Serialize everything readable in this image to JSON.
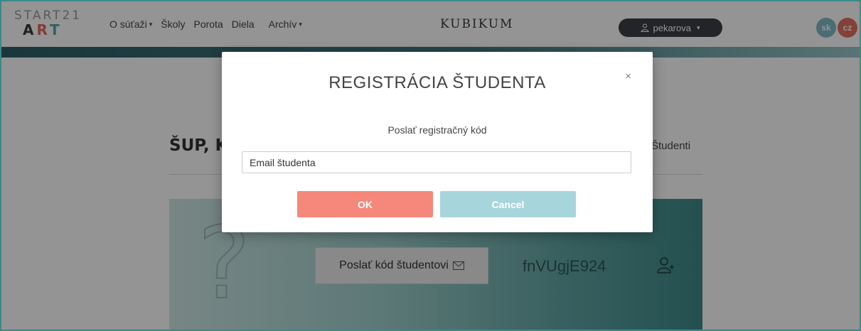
{
  "logo": {
    "top": "START21",
    "bottom": [
      "A",
      "R",
      "T"
    ]
  },
  "nav": {
    "items": [
      {
        "label": "O súťaži",
        "has_caret": true
      },
      {
        "label": "Školy"
      },
      {
        "label": "Porota"
      },
      {
        "label": "Diela"
      },
      {
        "label": "Archív",
        "has_caret": true
      }
    ],
    "caret": "▾"
  },
  "brand": "KUBIKUM",
  "user": {
    "name": "pekarova",
    "caret": "▾",
    "icon": "user-icon"
  },
  "languages": [
    "sk",
    "cz"
  ],
  "page": {
    "heading": "ŠUP, K",
    "students_link": "Študenti",
    "card": {
      "question_mark": "?",
      "send_code_button": "Poslať kód študentovi",
      "send_code_icon": "envelope-icon",
      "code": "fnVUgjE924",
      "add_user_icon": "add-user-icon"
    }
  },
  "modal": {
    "title": "REGISTRÁCIA ŠTUDENTA",
    "close": "×",
    "subtitle": "Poslať registračný kód",
    "email_placeholder": "Email študenta",
    "ok_label": "OK",
    "cancel_label": "Cancel"
  },
  "colors": {
    "ok_button": "#f5877b",
    "cancel_button": "#a6d5db",
    "user_pill": "#3b3f45",
    "lang_sk": "#7fbcc6",
    "lang_cz": "#e2705f"
  }
}
